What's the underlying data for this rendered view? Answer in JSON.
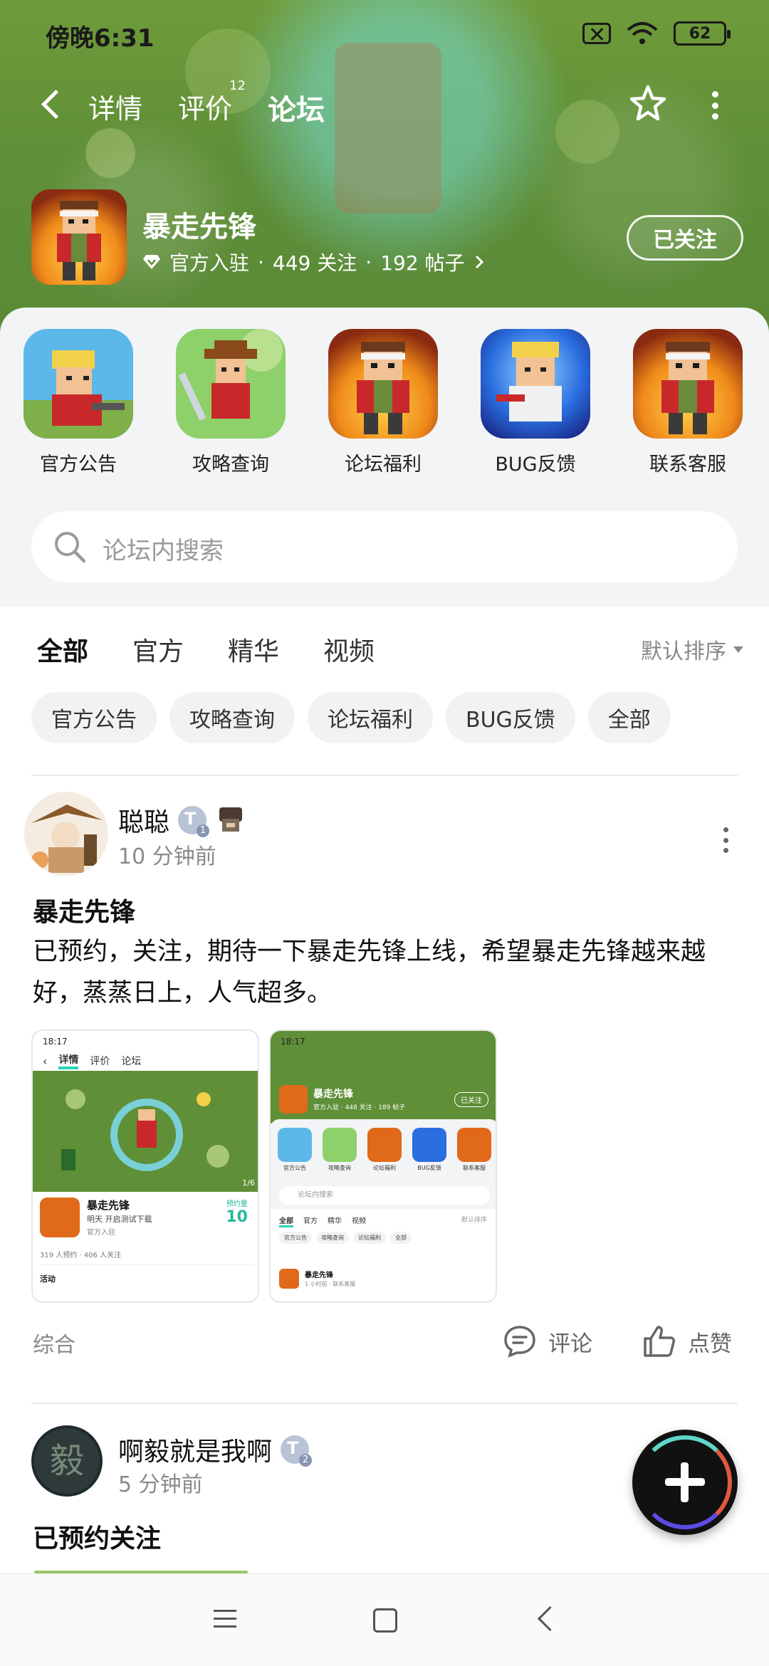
{
  "status_bar": {
    "time": "傍晚6:31",
    "battery": "62"
  },
  "top_nav": {
    "tabs": [
      {
        "label": "详情"
      },
      {
        "label": "评价",
        "badge": "12"
      },
      {
        "label": "论坛"
      }
    ],
    "active_tab": "论坛"
  },
  "game": {
    "name": "暴走先锋",
    "official": "官方入驻",
    "followers": "449 关注",
    "posts": "192 帖子",
    "follow_label": "已关注"
  },
  "shortcuts": [
    {
      "label": "官方公告"
    },
    {
      "label": "攻略查询"
    },
    {
      "label": "论坛福利"
    },
    {
      "label": "BUG反馈"
    },
    {
      "label": "联系客服"
    }
  ],
  "search": {
    "placeholder": "论坛内搜索"
  },
  "filter_tabs": [
    "全部",
    "官方",
    "精华",
    "视频"
  ],
  "sort": {
    "label": "默认排序"
  },
  "chips": [
    "官方公告",
    "攻略查询",
    "论坛福利",
    "BUG反馈",
    "全部"
  ],
  "posts": [
    {
      "user": "聪聪",
      "level": "1",
      "time": "10 分钟前",
      "title": "暴走先锋",
      "body": "已预约，关注，期待一下暴走先锋上线，希望暴走先锋越来越好，蒸蒸日上，人气超多。",
      "category": "综合",
      "comment_label": "评论",
      "like_label": "点赞",
      "thumb1": {
        "time": "18:17",
        "tabs": [
          "详情",
          "评价",
          "论坛"
        ],
        "game": "暴走先锋",
        "subtitle": "明天 开启测试下载",
        "official": "官方入驻",
        "stats": "319 人预约 · 406 人关注",
        "badge_label": "预约量",
        "badge_value": "10",
        "page": "1/6",
        "activity": "活动"
      },
      "thumb2": {
        "time": "18:17",
        "game": "暴走先锋",
        "meta": "官方入驻 · 448 关注 · 189 帖子",
        "follow": "已关注",
        "shortcuts": [
          "官方公告",
          "攻略查询",
          "论坛福利",
          "BUG反馈",
          "联系客服"
        ],
        "search": "论坛内搜索",
        "tabs": [
          "全部",
          "官方",
          "精华",
          "视频"
        ],
        "sort": "默认排序",
        "chips": [
          "官方公告",
          "攻略查询",
          "论坛福利",
          "全部"
        ],
        "post_title": "暴走先锋",
        "post_meta": "1 小时前 · 联系客服"
      }
    },
    {
      "user": "啊毅就是我啊",
      "level": "2",
      "time": "5 分钟前",
      "title": "已预约关注"
    }
  ],
  "colors": {
    "accent": "#2ad3b8",
    "hero_green": "#5f8f37"
  },
  "icons": [
    "back-icon",
    "star-icon",
    "more-icon",
    "search-icon",
    "comment-icon",
    "like-icon",
    "plus-icon"
  ]
}
